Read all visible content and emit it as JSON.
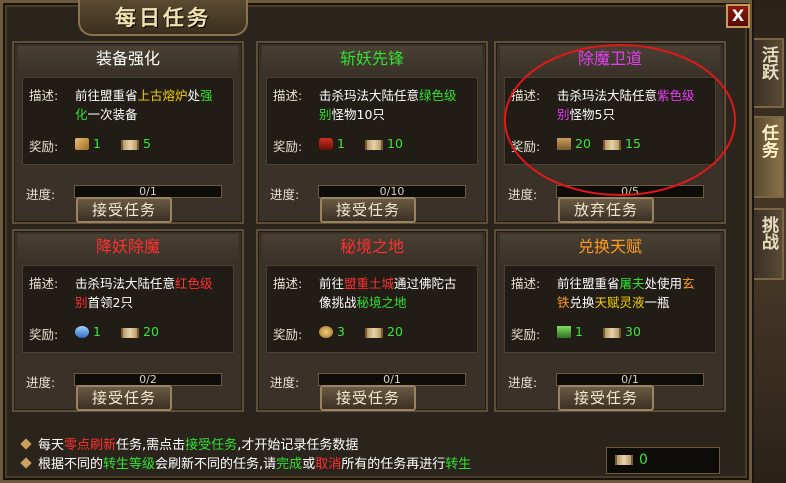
{
  "window": {
    "title": "每日任务",
    "close_label": "X"
  },
  "side_tabs": [
    "活跃",
    "任务",
    "挑战"
  ],
  "labels": {
    "desc": "描述:",
    "reward": "奖励:",
    "progress": "进度:"
  },
  "cards": [
    {
      "title": "装备强化",
      "title_color": "#ffffff",
      "desc": [
        {
          "t": "前往盟重省",
          "c": "c-white"
        },
        {
          "t": "上古熔炉",
          "c": "c-yellow"
        },
        {
          "t": "处",
          "c": "c-white"
        },
        {
          "t": "强化",
          "c": "c-green"
        },
        {
          "t": "一次装备",
          "c": "c-white"
        }
      ],
      "rewards": [
        {
          "icon": "bone-icon",
          "val": "1"
        },
        {
          "icon": "scroll-icon",
          "val": "5"
        }
      ],
      "progress": "0/1",
      "button": "接受任务"
    },
    {
      "title": "斩妖先锋",
      "title_color": "#33e033",
      "desc": [
        {
          "t": "击杀玛法大陆任意",
          "c": "c-white"
        },
        {
          "t": "绿色级别",
          "c": "c-green"
        },
        {
          "t": "怪物10只",
          "c": "c-white"
        }
      ],
      "rewards": [
        {
          "icon": "potion-icon",
          "val": "1"
        },
        {
          "icon": "scroll-icon",
          "val": "10"
        }
      ],
      "progress": "0/10",
      "button": "接受任务"
    },
    {
      "title": "除魔卫道",
      "title_color": "#e040f0",
      "desc": [
        {
          "t": "击杀玛法大陆任意",
          "c": "c-white"
        },
        {
          "t": "紫色级别",
          "c": "c-purple"
        },
        {
          "t": "怪物5只",
          "c": "c-white"
        }
      ],
      "rewards": [
        {
          "icon": "book-icon",
          "val": "20"
        },
        {
          "icon": "scroll-icon",
          "val": "15"
        }
      ],
      "progress": "0/5",
      "button": "放弃任务"
    },
    {
      "title": "降妖除魔",
      "title_color": "#ff3030",
      "desc": [
        {
          "t": "击杀玛法大陆任意",
          "c": "c-white"
        },
        {
          "t": "红色级别",
          "c": "c-red"
        },
        {
          "t": "首领2只",
          "c": "c-white"
        }
      ],
      "rewards": [
        {
          "icon": "gem-icon",
          "val": "1"
        },
        {
          "icon": "scroll-icon",
          "val": "20"
        }
      ],
      "progress": "0/2",
      "button": "接受任务"
    },
    {
      "title": "秘境之地",
      "title_color": "#ff3030",
      "desc": [
        {
          "t": "前往",
          "c": "c-white"
        },
        {
          "t": "盟重土城",
          "c": "c-red"
        },
        {
          "t": "通过佛陀古像挑战",
          "c": "c-white"
        },
        {
          "t": "秘境之地",
          "c": "c-green"
        }
      ],
      "rewards": [
        {
          "icon": "coin-icon",
          "val": "3"
        },
        {
          "icon": "scroll-icon",
          "val": "20"
        }
      ],
      "progress": "0/1",
      "button": "接受任务"
    },
    {
      "title": "兑换天赋",
      "title_color": "#ff9a20",
      "desc": [
        {
          "t": "前往盟重省",
          "c": "c-white"
        },
        {
          "t": "屠夫",
          "c": "c-green"
        },
        {
          "t": "处使用",
          "c": "c-white"
        },
        {
          "t": "玄铁",
          "c": "c-orange"
        },
        {
          "t": "兑换",
          "c": "c-white"
        },
        {
          "t": "天赋灵液",
          "c": "c-yellow"
        },
        {
          "t": "一瓶",
          "c": "c-white"
        }
      ],
      "rewards": [
        {
          "icon": "herb-icon",
          "val": "1"
        },
        {
          "icon": "scroll-icon",
          "val": "30"
        }
      ],
      "progress": "0/1",
      "button": "接受任务"
    }
  ],
  "notes": [
    [
      {
        "t": "每天",
        "c": "c-white"
      },
      {
        "t": "零点刷新",
        "c": "c-red"
      },
      {
        "t": "任务,需点击",
        "c": "c-white"
      },
      {
        "t": "接受任务",
        "c": "c-green"
      },
      {
        "t": ",才开始记录任务数据",
        "c": "c-white"
      }
    ],
    [
      {
        "t": "根据不同的",
        "c": "c-white"
      },
      {
        "t": "转生等级",
        "c": "c-green"
      },
      {
        "t": "会刷新不同的任务,请",
        "c": "c-white"
      },
      {
        "t": "完成",
        "c": "c-green"
      },
      {
        "t": "或",
        "c": "c-white"
      },
      {
        "t": "取消",
        "c": "c-red"
      },
      {
        "t": "所有的任务再进行",
        "c": "c-white"
      },
      {
        "t": "转生",
        "c": "c-green"
      }
    ]
  ],
  "scroll_count": "0"
}
